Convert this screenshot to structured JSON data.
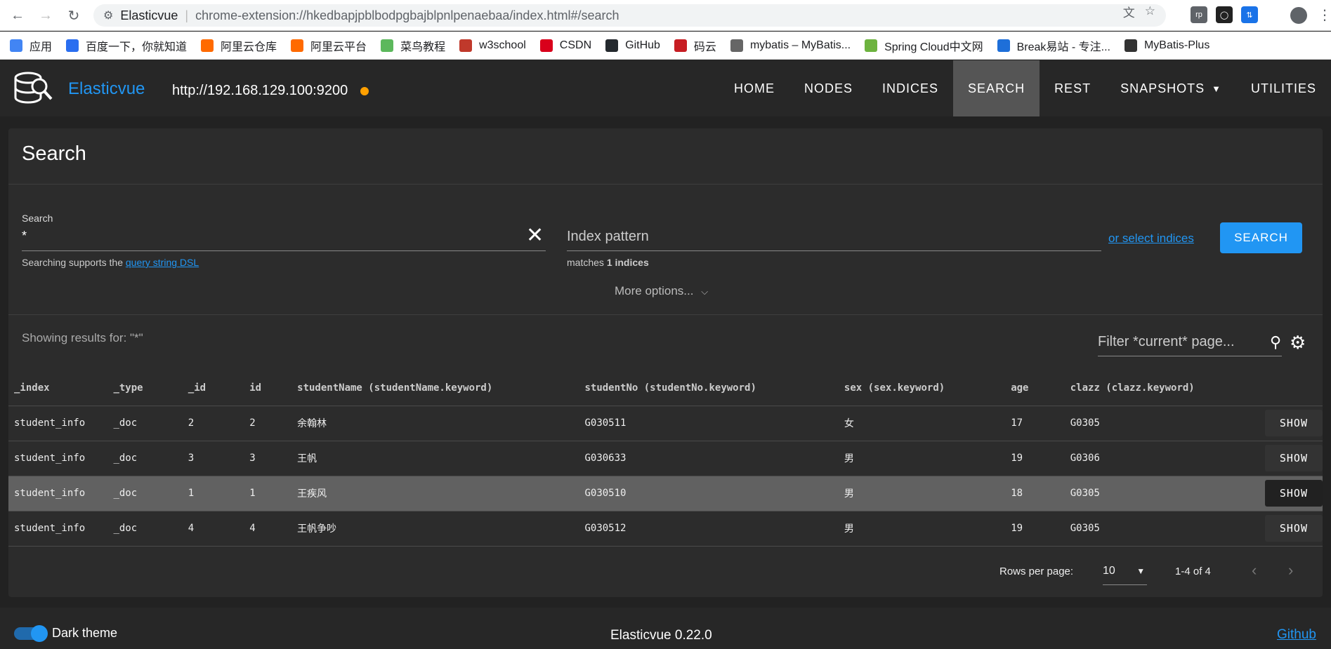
{
  "browser": {
    "site_label": "Elasticvue",
    "url": "chrome-extension://hkedbapjpblbodpgbajblpnlpenaebaa/index.html#/search",
    "bookmarks": [
      "应用",
      "百度一下，你就知道",
      "阿里云仓库",
      "阿里云平台",
      "菜鸟教程",
      "w3school",
      "CSDN",
      "GitHub",
      "码云",
      "mybatis – MyBatis...",
      "Spring Cloud中文网",
      "Break易站 - 专注...",
      "MyBatis-Plus"
    ],
    "bookmark_colors": [
      "#4285f4",
      "#2a6ef0",
      "#ff6a00",
      "#ff6a00",
      "#5cb85c",
      "#c0392b",
      "#d9001b",
      "#24292e",
      "#c71d23",
      "#666666",
      "#6db33f",
      "#1e6fd9",
      "#333333"
    ]
  },
  "app": {
    "title": "Elasticvue",
    "cluster_url": "http://192.168.129.100:9200",
    "cluster_status_color": "#ffa000",
    "nav": [
      "HOME",
      "NODES",
      "INDICES",
      "SEARCH",
      "REST",
      "SNAPSHOTS",
      "UTILITIES"
    ],
    "active_nav": "SEARCH"
  },
  "search": {
    "heading": "Search",
    "query_label": "Search",
    "query_value": "*",
    "hint_prefix": "Searching supports the",
    "hint_link": "query string DSL",
    "index_placeholder": "Index pattern",
    "matches_prefix": "matches",
    "matches_count": "1 indices",
    "select_indices": "or select indices",
    "search_button": "SEARCH",
    "more_options": "More options...",
    "showing": "Showing results for: \"*\"",
    "filter_placeholder": "Filter *current* page..."
  },
  "table": {
    "columns": [
      "_index",
      "_type",
      "_id",
      "id",
      "studentName (studentName.keyword)",
      "studentNo (studentNo.keyword)",
      "sex (sex.keyword)",
      "age",
      "clazz (clazz.keyword)",
      ""
    ],
    "rows": [
      [
        "student_info",
        "_doc",
        "2",
        "2",
        "余翰林",
        "G030511",
        "女",
        "17",
        "G0305",
        "SHOW"
      ],
      [
        "student_info",
        "_doc",
        "3",
        "3",
        "王帆",
        "G030633",
        "男",
        "19",
        "G0306",
        "SHOW"
      ],
      [
        "student_info",
        "_doc",
        "1",
        "1",
        "王疾风",
        "G030510",
        "男",
        "18",
        "G0305",
        "SHOW"
      ],
      [
        "student_info",
        "_doc",
        "4",
        "4",
        "王帆争吵",
        "G030512",
        "男",
        "19",
        "G0305",
        "SHOW"
      ]
    ],
    "highlighted_row": 2
  },
  "pagination": {
    "rows_per_page_label": "Rows per page:",
    "rows_per_page": "10",
    "range": "1-4 of 4"
  },
  "footer": {
    "dark_theme_label": "Dark theme",
    "version": "Elasticvue 0.22.0",
    "github": "Github"
  }
}
